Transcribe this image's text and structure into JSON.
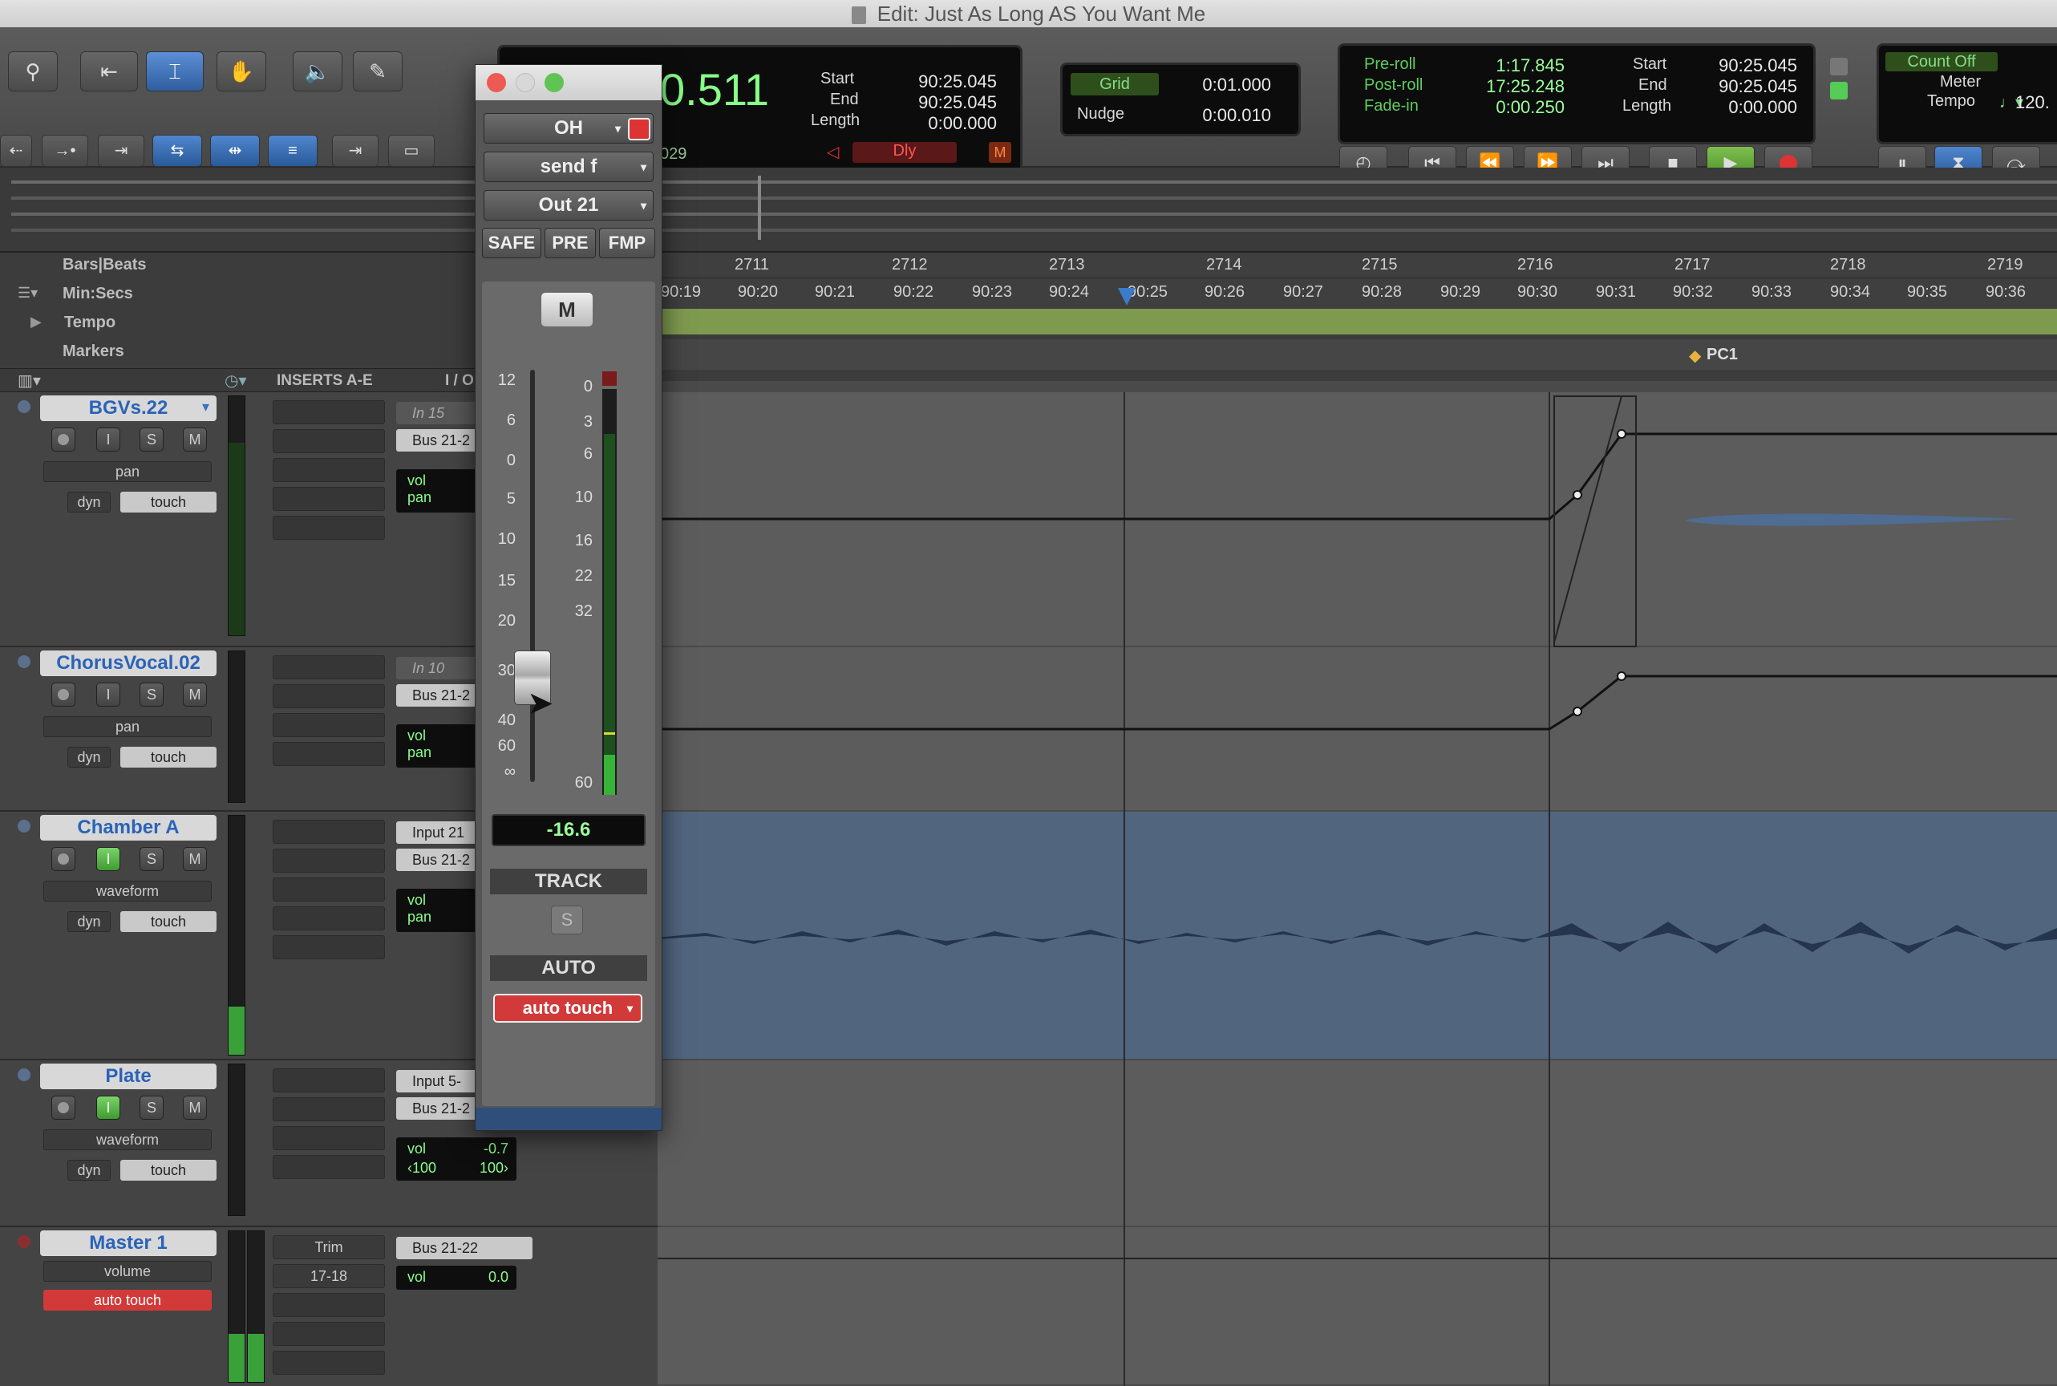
{
  "window": {
    "title": "Edit: Just As Long AS You Want Me"
  },
  "toolbar": {
    "counter_main": "0.511",
    "counter_small": "029",
    "counter_start_label": "Start",
    "counter_start": "90:25.045",
    "counter_end_label": "End",
    "counter_end": "90:25.045",
    "counter_length_label": "Length",
    "counter_length": "0:00.000",
    "dly_label": "Dly",
    "grid_label": "Grid",
    "grid_value": "0:01.000",
    "nudge_label": "Nudge",
    "nudge_value": "0:00.010",
    "preroll_label": "Pre-roll",
    "preroll_value": "1:17.845",
    "postroll_label": "Post-roll",
    "postroll_value": "17:25.248",
    "fadein_label": "Fade-in",
    "fadein_value": "0:00.250",
    "start_label": "Start",
    "start_value": "90:25.045",
    "end_label": "End",
    "end_value": "90:25.045",
    "length_label": "Length",
    "length_value": "0:00.000",
    "count_off": "Count Off",
    "meter": "Meter",
    "tempo": "Tempo",
    "tempo_value": "120."
  },
  "rulers": {
    "bars_beats": "Bars|Beats",
    "min_secs": "Min:Secs",
    "tempo": "Tempo",
    "markers": "Markers",
    "bar_ticks": [
      "2711",
      "2712",
      "2713",
      "2714",
      "2715",
      "2716",
      "2717",
      "2718",
      "2719"
    ],
    "min_ticks": [
      "90:19",
      "90:20",
      "90:21",
      "90:22",
      "90:23",
      "90:24",
      "90:25",
      "90:26",
      "90:27",
      "90:28",
      "90:29",
      "90:30",
      "90:31",
      "90:32",
      "90:33",
      "90:34",
      "90:35",
      "90:36"
    ],
    "marker_name": "PC1"
  },
  "columns": {
    "inserts": "INSERTS A-E",
    "io": "I / O"
  },
  "tracks": [
    {
      "name": "BGVs.22",
      "view": "pan",
      "dyn": "dyn",
      "auto": "touch",
      "input": "In 15",
      "output": "Bus 21-2",
      "vol": "vol",
      "pan": "pan"
    },
    {
      "name": "ChorusVocal.02",
      "view": "pan",
      "dyn": "dyn",
      "auto": "touch",
      "input": "In 10",
      "output": "Bus 21-2",
      "vol": "vol",
      "pan": "pan"
    },
    {
      "name": "Chamber A",
      "view": "waveform",
      "dyn": "dyn",
      "auto": "touch",
      "input": "Input 21",
      "output": "Bus 21-2",
      "vol": "vol",
      "pan": "pan"
    },
    {
      "name": "Plate",
      "view": "waveform",
      "dyn": "dyn",
      "auto": "touch",
      "input": "Input 5-",
      "output": "Bus 21-2",
      "vol": "vol",
      "vol_value": "-0.7",
      "pan_l": "‹100",
      "pan_r": "100›"
    },
    {
      "name": "Master 1",
      "view": "volume",
      "auto": "auto touch",
      "insert1": "Trim",
      "insert2": "17-18",
      "output": "Bus 21-22",
      "vol": "vol",
      "vol_value": "0.0"
    }
  ],
  "fader_window": {
    "track": "OH",
    "send": "send f",
    "output": "Out 21",
    "safe": "SAFE",
    "pre": "PRE",
    "fmp": "FMP",
    "mute": "M",
    "fader_scale": [
      "12",
      "6",
      "0",
      "5",
      "10",
      "15",
      "20",
      "30",
      "40",
      "60",
      "∞"
    ],
    "meter_scale": [
      "0",
      "3",
      "6",
      "10",
      "16",
      "22",
      "32",
      "60"
    ],
    "value": "-16.6",
    "track_label": "TRACK",
    "solo": "S",
    "auto_label": "AUTO",
    "auto_mode": "auto touch"
  },
  "colors": {
    "accent_blue": "#2a63b8",
    "record_red": "#d23a3a",
    "lcd_green": "#5ccf5c",
    "region_blue": "#52657f"
  }
}
